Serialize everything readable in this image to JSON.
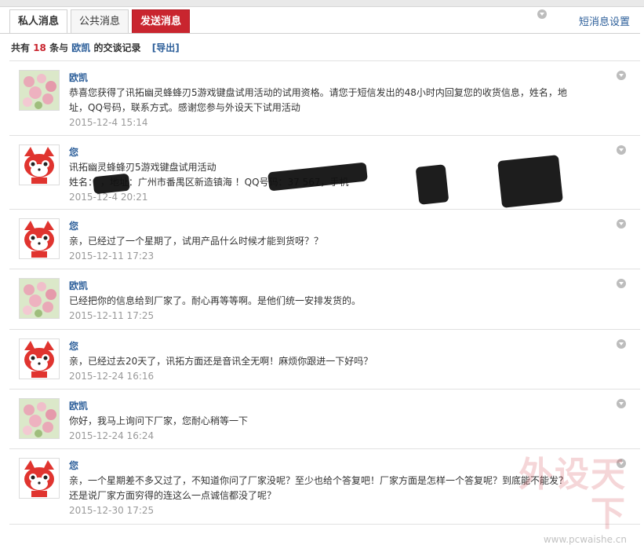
{
  "tabs": {
    "private": "私人消息",
    "public": "公共消息",
    "send": "发送消息"
  },
  "settings_link": "短消息设置",
  "summary": {
    "prefix": "共有",
    "count": "18",
    "mid": "条与",
    "name": "欧凯",
    "suffix": "的交谈记录",
    "export": "[导出]"
  },
  "messages": [
    {
      "sender": "欧凯",
      "text": "恭喜您获得了讯拓幽灵蜂蜂刃5游戏键盘试用活动的试用资格。请您于短信发出的48小时内回复您的收货信息，姓名，地址，QQ号码，联系方式。感谢您参与外设天下试用活动",
      "time": "2015-12-4 15:14",
      "avatar": "flower"
    },
    {
      "sender": "您",
      "text": "讯拓幽灵蜂蜂刃5游戏键盘试用活动",
      "text2": "姓名：        ，地址：广州市番禺区新造镇海                ！QQ号码：37     567，手机",
      "time": "2015-12-4 20:21",
      "avatar": "fox"
    },
    {
      "sender": "您",
      "text": "亲，已经过了一个星期了，试用产品什么时候才能到货呀？？",
      "time": "2015-12-11 17:23",
      "avatar": "fox"
    },
    {
      "sender": "欧凯",
      "text": "已经把你的信息给到厂家了。耐心再等等啊。是他们统一安排发货的。",
      "time": "2015-12-11 17:25",
      "avatar": "flower"
    },
    {
      "sender": "您",
      "text": "亲，已经过去20天了，讯拓方面还是音讯全无啊！麻烦你跟进一下好吗？",
      "time": "2015-12-24 16:16",
      "avatar": "fox"
    },
    {
      "sender": "欧凯",
      "text": "你好，我马上询问下厂家，您耐心稍等一下",
      "time": "2015-12-24 16:24",
      "avatar": "flower"
    },
    {
      "sender": "您",
      "text": "亲，一个星期差不多又过了，不知道你问了厂家没呢？至少也给个答复吧！厂家方面是怎样一个答复呢？到底能不能发？还是说厂家方面穷得的连这么一点诚信都没了呢？",
      "time": "2015-12-30 17:25",
      "avatar": "fox"
    }
  ],
  "watermark": {
    "brand": "外设天下",
    "url": "www.pcwaishe.cn"
  }
}
